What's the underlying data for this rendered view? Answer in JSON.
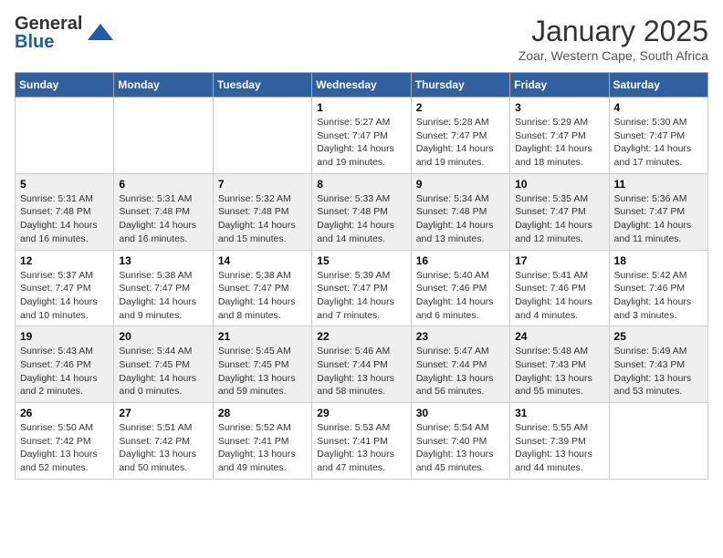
{
  "logo": {
    "general": "General",
    "blue": "Blue"
  },
  "title": "January 2025",
  "location": "Zoar, Western Cape, South Africa",
  "days_of_week": [
    "Sunday",
    "Monday",
    "Tuesday",
    "Wednesday",
    "Thursday",
    "Friday",
    "Saturday"
  ],
  "weeks": [
    [
      {
        "day": "",
        "info": ""
      },
      {
        "day": "",
        "info": ""
      },
      {
        "day": "",
        "info": ""
      },
      {
        "day": "1",
        "info": "Sunrise: 5:27 AM\nSunset: 7:47 PM\nDaylight: 14 hours\nand 19 minutes."
      },
      {
        "day": "2",
        "info": "Sunrise: 5:28 AM\nSunset: 7:47 PM\nDaylight: 14 hours\nand 19 minutes."
      },
      {
        "day": "3",
        "info": "Sunrise: 5:29 AM\nSunset: 7:47 PM\nDaylight: 14 hours\nand 18 minutes."
      },
      {
        "day": "4",
        "info": "Sunrise: 5:30 AM\nSunset: 7:47 PM\nDaylight: 14 hours\nand 17 minutes."
      }
    ],
    [
      {
        "day": "5",
        "info": "Sunrise: 5:31 AM\nSunset: 7:48 PM\nDaylight: 14 hours\nand 16 minutes."
      },
      {
        "day": "6",
        "info": "Sunrise: 5:31 AM\nSunset: 7:48 PM\nDaylight: 14 hours\nand 16 minutes."
      },
      {
        "day": "7",
        "info": "Sunrise: 5:32 AM\nSunset: 7:48 PM\nDaylight: 14 hours\nand 15 minutes."
      },
      {
        "day": "8",
        "info": "Sunrise: 5:33 AM\nSunset: 7:48 PM\nDaylight: 14 hours\nand 14 minutes."
      },
      {
        "day": "9",
        "info": "Sunrise: 5:34 AM\nSunset: 7:48 PM\nDaylight: 14 hours\nand 13 minutes."
      },
      {
        "day": "10",
        "info": "Sunrise: 5:35 AM\nSunset: 7:47 PM\nDaylight: 14 hours\nand 12 minutes."
      },
      {
        "day": "11",
        "info": "Sunrise: 5:36 AM\nSunset: 7:47 PM\nDaylight: 14 hours\nand 11 minutes."
      }
    ],
    [
      {
        "day": "12",
        "info": "Sunrise: 5:37 AM\nSunset: 7:47 PM\nDaylight: 14 hours\nand 10 minutes."
      },
      {
        "day": "13",
        "info": "Sunrise: 5:38 AM\nSunset: 7:47 PM\nDaylight: 14 hours\nand 9 minutes."
      },
      {
        "day": "14",
        "info": "Sunrise: 5:38 AM\nSunset: 7:47 PM\nDaylight: 14 hours\nand 8 minutes."
      },
      {
        "day": "15",
        "info": "Sunrise: 5:39 AM\nSunset: 7:47 PM\nDaylight: 14 hours\nand 7 minutes."
      },
      {
        "day": "16",
        "info": "Sunrise: 5:40 AM\nSunset: 7:46 PM\nDaylight: 14 hours\nand 6 minutes."
      },
      {
        "day": "17",
        "info": "Sunrise: 5:41 AM\nSunset: 7:46 PM\nDaylight: 14 hours\nand 4 minutes."
      },
      {
        "day": "18",
        "info": "Sunrise: 5:42 AM\nSunset: 7:46 PM\nDaylight: 14 hours\nand 3 minutes."
      }
    ],
    [
      {
        "day": "19",
        "info": "Sunrise: 5:43 AM\nSunset: 7:46 PM\nDaylight: 14 hours\nand 2 minutes."
      },
      {
        "day": "20",
        "info": "Sunrise: 5:44 AM\nSunset: 7:45 PM\nDaylight: 14 hours\nand 0 minutes."
      },
      {
        "day": "21",
        "info": "Sunrise: 5:45 AM\nSunset: 7:45 PM\nDaylight: 13 hours\nand 59 minutes."
      },
      {
        "day": "22",
        "info": "Sunrise: 5:46 AM\nSunset: 7:44 PM\nDaylight: 13 hours\nand 58 minutes."
      },
      {
        "day": "23",
        "info": "Sunrise: 5:47 AM\nSunset: 7:44 PM\nDaylight: 13 hours\nand 56 minutes."
      },
      {
        "day": "24",
        "info": "Sunrise: 5:48 AM\nSunset: 7:43 PM\nDaylight: 13 hours\nand 55 minutes."
      },
      {
        "day": "25",
        "info": "Sunrise: 5:49 AM\nSunset: 7:43 PM\nDaylight: 13 hours\nand 53 minutes."
      }
    ],
    [
      {
        "day": "26",
        "info": "Sunrise: 5:50 AM\nSunset: 7:42 PM\nDaylight: 13 hours\nand 52 minutes."
      },
      {
        "day": "27",
        "info": "Sunrise: 5:51 AM\nSunset: 7:42 PM\nDaylight: 13 hours\nand 50 minutes."
      },
      {
        "day": "28",
        "info": "Sunrise: 5:52 AM\nSunset: 7:41 PM\nDaylight: 13 hours\nand 49 minutes."
      },
      {
        "day": "29",
        "info": "Sunrise: 5:53 AM\nSunset: 7:41 PM\nDaylight: 13 hours\nand 47 minutes."
      },
      {
        "day": "30",
        "info": "Sunrise: 5:54 AM\nSunset: 7:40 PM\nDaylight: 13 hours\nand 45 minutes."
      },
      {
        "day": "31",
        "info": "Sunrise: 5:55 AM\nSunset: 7:39 PM\nDaylight: 13 hours\nand 44 minutes."
      },
      {
        "day": "",
        "info": ""
      }
    ]
  ]
}
